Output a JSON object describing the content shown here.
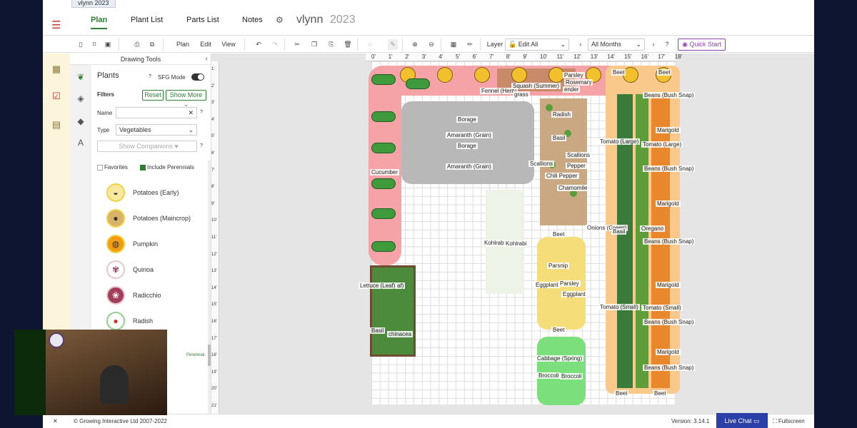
{
  "window_tab": "vlynn 2023",
  "nav": {
    "plan": "Plan",
    "plant_list": "Plant List",
    "parts_list": "Parts List",
    "notes": "Notes"
  },
  "plan_title": {
    "name": "vlynn",
    "year": "2023"
  },
  "toolbar": {
    "plan": "Plan",
    "edit": "Edit",
    "view": "View",
    "layer_label": "Layer",
    "layer_value": "Edit All",
    "months_value": "All Months",
    "quick_start": "Quick Start"
  },
  "panel": {
    "title": "Drawing Tools",
    "plants_heading": "Plants",
    "sfg_mode": "SFG Mode",
    "filters": "Filters",
    "reset": "Reset",
    "show_more": "Show More",
    "name_label": "Name",
    "type_label": "Type",
    "type_value": "Vegetables",
    "show_companions": "Show Companions",
    "favorites": "Favorites",
    "include_perennials": "Include Perennials",
    "perennial_badge": "Perennial",
    "plants": [
      {
        "name": "Potatoes (Early)",
        "icon": "potato-icon"
      },
      {
        "name": "Potatoes (Maincrop)",
        "icon": "potato-icon"
      },
      {
        "name": "Pumpkin",
        "icon": "pumpkin-icon"
      },
      {
        "name": "Quinoa",
        "icon": "quinoa-icon"
      },
      {
        "name": "Radicchio",
        "icon": "radicchio-icon"
      },
      {
        "name": "Radish",
        "icon": "radish-icon"
      }
    ]
  },
  "ruler_top": [
    "0'",
    "1'",
    "2'",
    "3'",
    "4'",
    "5'",
    "6'",
    "7'",
    "8'",
    "9'",
    "10'",
    "11'",
    "12'",
    "13'",
    "14'",
    "15'",
    "16'",
    "17'",
    "18'"
  ],
  "ruler_left": [
    "1'",
    "2'",
    "3'",
    "4'",
    "5'",
    "6'",
    "7'",
    "8'",
    "9'",
    "10'",
    "11'",
    "12'",
    "13'",
    "14'",
    "15'",
    "16'",
    "17'",
    "18'",
    "19'",
    "20'",
    "21'"
  ],
  "labels": {
    "fennel": "Fennel (Herb)",
    "squash": "Squash (Summer)",
    "lemongrass": "grass",
    "parsley_top": "Parsley",
    "rosemary": "Rosemary",
    "lavender": "ender",
    "beet_tr1": "Beet",
    "beet_tr2": "Beet",
    "borage1": "Borage",
    "amaranth1": "Amaranth (Grain)",
    "borage2": "Borage",
    "amaranth2": "Amaranth (Grain)",
    "cucumber": "Cucumber",
    "radish": "Radish",
    "basil1": "Basil",
    "scallions1": "Scallions",
    "scallions2": "Scallions",
    "pepper": "Pepper",
    "chili": "Chili Pepper",
    "chamomile": "Chamomile",
    "tomato_large1": "Tomato (Large)",
    "tomato_large2": "Tomato (Large)",
    "beans1": "Beans (Bush Snap)",
    "beans2": "Beans (Bush Snap)",
    "beans3": "Beans (Bush Snap)",
    "beans4": "Beans (Bush Snap)",
    "beans5": "Beans (Bush Snap)",
    "marigold1": "Marigold",
    "marigold2": "Marigold",
    "marigold3": "Marigold",
    "marigold4": "Marigold",
    "onions": "Onions (Green)",
    "oregano": "Oregano",
    "lettuce": "Lettuce (Leaf)",
    "lettuce2": "af)",
    "kohlrabi1": "Kohlrabi",
    "kohlrabi2": "Kohlrabi",
    "beet_mid": "Beet",
    "basil2": "Basil",
    "parsnip": "Parsnip",
    "eggplant1": "Eggplant",
    "parsley2": "Parsley",
    "eggplant2": "Eggplant",
    "beet_low": "Beet",
    "tomato_small1": "Tomato (Small)",
    "tomato_small2": "Tomato (Small)",
    "cabbage": "Cabbage (Spring)",
    "broccoli1": "Broccoli",
    "broccoli2": "Broccoli",
    "basil3": "Basil",
    "echinacea": "chinacea",
    "beet_b1": "Beet",
    "beet_b2": "Beet"
  },
  "footer": {
    "copyright": "© Growing Interactive Ltd 2007-2022",
    "version": "Version: 3.14.1",
    "live_chat": "Live Chat",
    "fullscreen": "Fullscreen"
  },
  "colors": {
    "accent": "#2e7d32",
    "brand_red": "#c0392b",
    "cucumber_zone": "#f6a3a8",
    "grain_zone": "#b8b8b8",
    "yellow_zone": "#f5de7a",
    "brassica_zone": "#7be07b",
    "tomato_zone": "#f8c98a"
  }
}
